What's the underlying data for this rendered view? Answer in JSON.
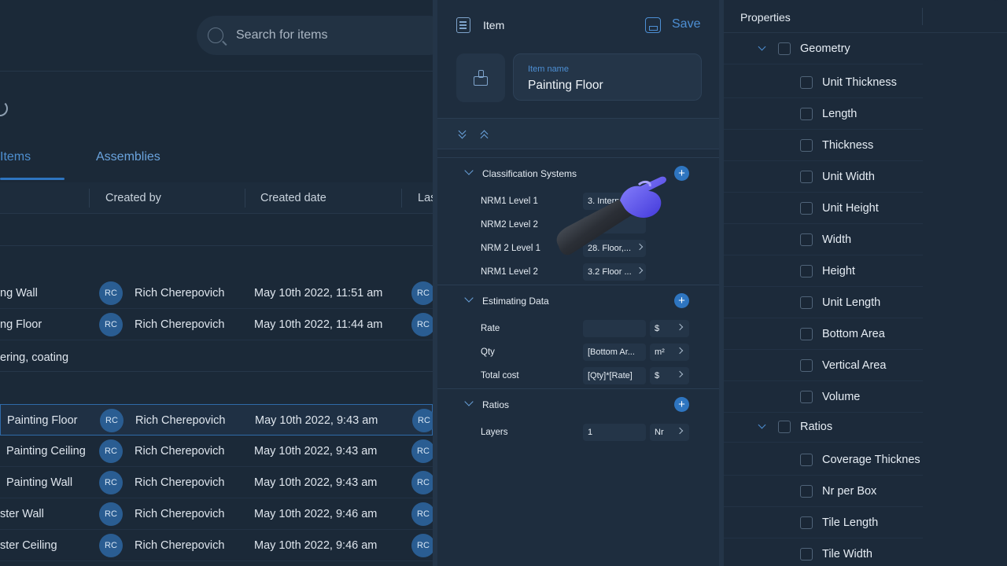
{
  "list": {
    "search_placeholder": "Search for items",
    "tabs": [
      {
        "label": "Items"
      },
      {
        "label": "Assemblies"
      }
    ],
    "columns": [
      {
        "label": "Created by"
      },
      {
        "label": "Created date"
      },
      {
        "label": "Las"
      }
    ],
    "group_label": "ering, coating",
    "rows": [
      {
        "name": "ng Wall",
        "avatar": "RC",
        "created_by": "Rich Cherepovich",
        "date": "May 10th 2022, 11:51 am",
        "avatar2": "RC"
      },
      {
        "name": "ng Floor",
        "avatar": "RC",
        "created_by": "Rich Cherepovich",
        "date": "May 10th 2022, 11:44 am",
        "avatar2": "RC"
      },
      {
        "name": "Painting Floor",
        "avatar": "RC",
        "created_by": "Rich Cherepovich",
        "date": "May 10th 2022, 9:43 am",
        "avatar2": "RC"
      },
      {
        "name": "Painting Ceiling",
        "avatar": "RC",
        "created_by": "Rich Cherepovich",
        "date": "May 10th 2022, 9:43 am",
        "avatar2": "RC"
      },
      {
        "name": "Painting Wall",
        "avatar": "RC",
        "created_by": "Rich Cherepovich",
        "date": "May 10th 2022, 9:43 am",
        "avatar2": "RC"
      },
      {
        "name": "ster Wall",
        "avatar": "RC",
        "created_by": "Rich Cherepovich",
        "date": "May 10th 2022, 9:46 am",
        "avatar2": "RC"
      },
      {
        "name": "ster Ceiling",
        "avatar": "RC",
        "created_by": "Rich Cherepovich",
        "date": "May 10th 2022, 9:46 am",
        "avatar2": "RC"
      }
    ]
  },
  "item": {
    "title": "Item",
    "save_label": "Save",
    "name_label": "Item name",
    "name_value": "Painting Floor",
    "sections": {
      "classification": {
        "title": "Classification Systems",
        "rows": [
          {
            "label": "NRM1 Level 1",
            "value": "3. Intern"
          },
          {
            "label": "NRM2 Level 2",
            "value": ""
          },
          {
            "label": "NRM 2 Level 1",
            "value": "28. Floor,..."
          },
          {
            "label": "NRM1 Level 2",
            "value": "3.2 Floor ..."
          }
        ]
      },
      "estimating": {
        "title": "Estimating Data",
        "rows": [
          {
            "label": "Rate",
            "value": "",
            "unit": "$"
          },
          {
            "label": "Qty",
            "value": "[Bottom Ar...",
            "unit": "m²"
          },
          {
            "label": "Total cost",
            "value": "[Qty]*[Rate]",
            "unit": "$"
          }
        ]
      },
      "ratios": {
        "title": "Ratios",
        "rows": [
          {
            "label": "Layers",
            "value": "1",
            "unit": "Nr"
          }
        ]
      }
    }
  },
  "properties": {
    "title": "Properties",
    "groups": [
      {
        "label": "Geometry",
        "items": [
          "Unit Thickness",
          "Length",
          "Thickness",
          "Unit Width",
          "Unit Height",
          "Width",
          "Height",
          "Unit Length",
          "Bottom Area",
          "Vertical Area",
          "Volume"
        ]
      },
      {
        "label": "Ratios",
        "items": [
          "Coverage Thicknes",
          "Nr per Box",
          "Tile Length",
          "Tile Width"
        ]
      }
    ]
  },
  "colors": {
    "accent": "#2e75c0",
    "background": "#1c2a3a",
    "panel": "#1e2d3e"
  }
}
